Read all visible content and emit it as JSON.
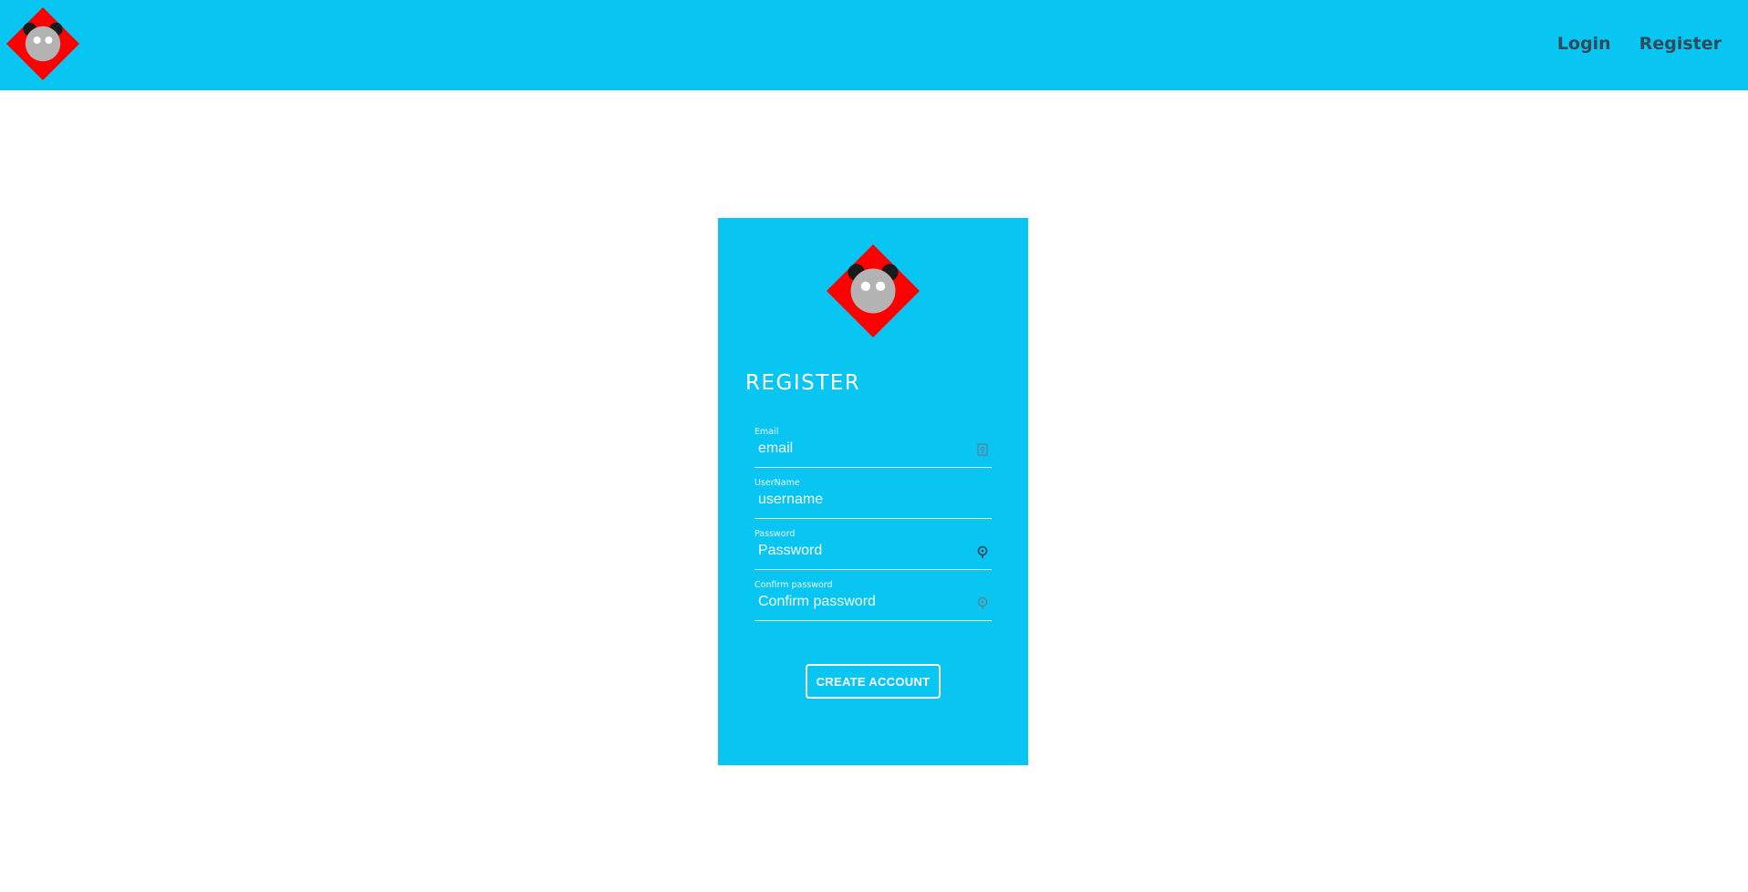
{
  "nav": {
    "logo_icon": "panda-logo-icon",
    "links": [
      {
        "label": "Login"
      },
      {
        "label": "Register"
      }
    ]
  },
  "card": {
    "logo_icon": "panda-logo-icon",
    "title": "REGISTER",
    "fields": {
      "email": {
        "label": "Email",
        "placeholder": "email",
        "icon": "contact-card-icon"
      },
      "username": {
        "label": "UserName",
        "placeholder": "username"
      },
      "password": {
        "label": "Password",
        "placeholder": "Password",
        "icon": "key-icon"
      },
      "confirm": {
        "label": "Confirm password",
        "placeholder": "Confirm password",
        "icon": "key-icon"
      }
    },
    "submit_label": "CREATE ACCOUNT"
  },
  "colors": {
    "brand_cyan": "#08c5f2",
    "logo_red": "#ff0000",
    "nav_text": "#2f4a5a"
  }
}
